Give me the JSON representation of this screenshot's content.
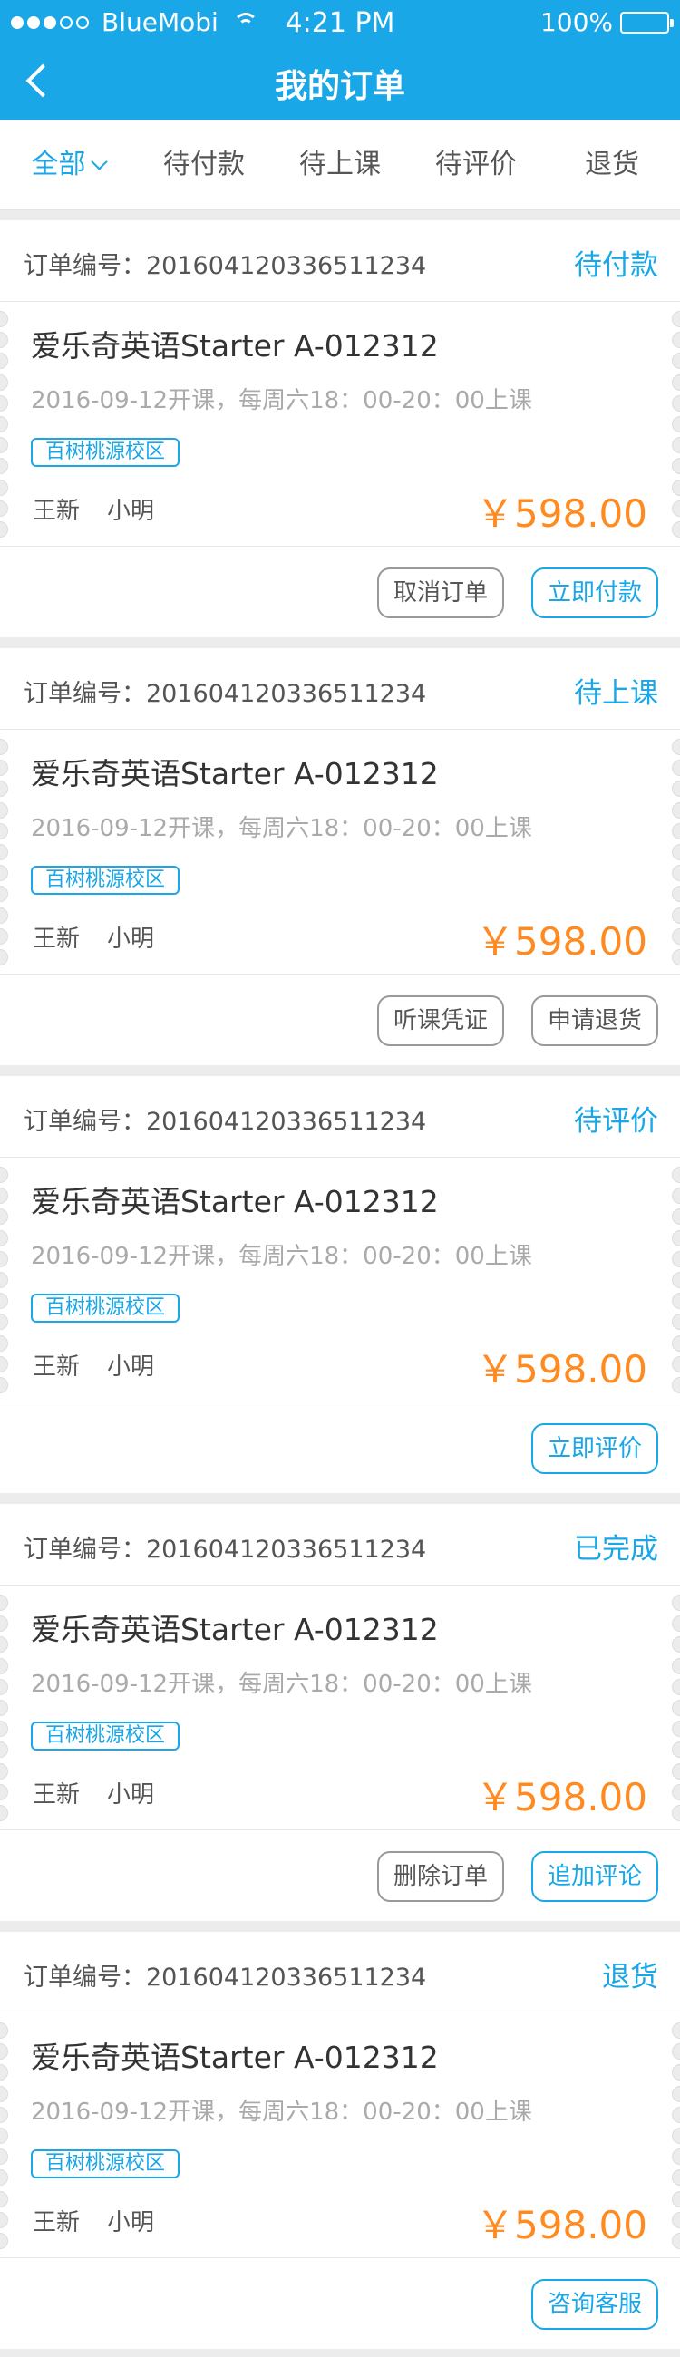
{
  "status_bar": {
    "carrier": "BlueMobi",
    "time": "4:21 PM",
    "battery": "100%"
  },
  "nav": {
    "title": "我的订单"
  },
  "tabs": [
    {
      "label": "全部"
    },
    {
      "label": "待付款"
    },
    {
      "label": "待上课"
    },
    {
      "label": "待评价"
    },
    {
      "label": "退货"
    }
  ],
  "orders": [
    {
      "order_no_label": "订单编号：201604120336511234",
      "status": "待付款",
      "course": "爱乐奇英语Starter A-012312",
      "schedule": "2016-09-12开课，每周六18：00-20：00上课",
      "campus": "百树桃源校区",
      "teacher1": "王新",
      "teacher2": "小明",
      "price": "￥598.00",
      "button1": "取消订单",
      "button2": "立即付款"
    },
    {
      "order_no_label": "订单编号：201604120336511234",
      "status": "待上课",
      "course": "爱乐奇英语Starter A-012312",
      "schedule": "2016-09-12开课，每周六18：00-20：00上课",
      "campus": "百树桃源校区",
      "teacher1": "王新",
      "teacher2": "小明",
      "price": "￥598.00",
      "button1": "听课凭证",
      "button2": "申请退货"
    },
    {
      "order_no_label": "订单编号：201604120336511234",
      "status": "待评价",
      "course": "爱乐奇英语Starter A-012312",
      "schedule": "2016-09-12开课，每周六18：00-20：00上课",
      "campus": "百树桃源校区",
      "teacher1": "王新",
      "teacher2": "小明",
      "price": "￥598.00",
      "button2": "立即评价"
    },
    {
      "order_no_label": "订单编号：201604120336511234",
      "status": "已完成",
      "course": "爱乐奇英语Starter A-012312",
      "schedule": "2016-09-12开课，每周六18：00-20：00上课",
      "campus": "百树桃源校区",
      "teacher1": "王新",
      "teacher2": "小明",
      "price": "￥598.00",
      "button1": "删除订单",
      "button2": "追加评论"
    },
    {
      "order_no_label": "订单编号：201604120336511234",
      "status": "退货",
      "course": "爱乐奇英语Starter A-012312",
      "schedule": "2016-09-12开课，每周六18：00-20：00上课",
      "campus": "百树桃源校区",
      "teacher1": "王新",
      "teacher2": "小明",
      "price": "￥598.00",
      "button2": "咨询客服"
    }
  ],
  "colors": {
    "accent": "#19a7e8",
    "price": "#ff8a1f",
    "background": "#ececec"
  }
}
